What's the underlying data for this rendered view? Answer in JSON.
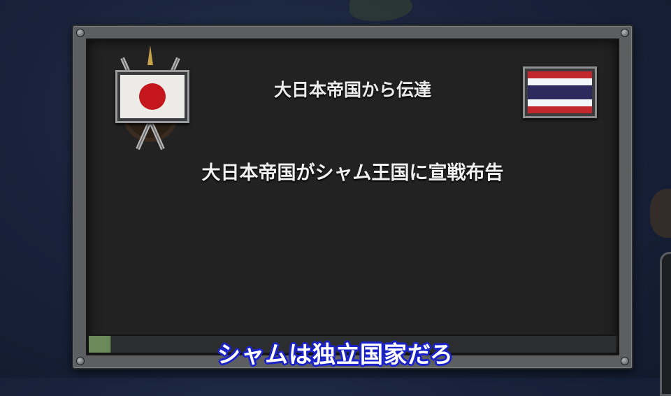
{
  "dialog": {
    "title": "大日本帝国から伝達",
    "message": "大日本帝国がシャム王国に宣戦布告",
    "sender_flag": "japan-flag-icon",
    "receiver_flag": "thailand-flag-icon",
    "emblem": "crossed-swords-icon",
    "progress": 0.04
  },
  "subtitle": "シャムは独立国家だろ",
  "colors": {
    "subtitle_outline": "#1b22c9",
    "panel_bg": "#222223",
    "frame": "#5d5e5f"
  }
}
